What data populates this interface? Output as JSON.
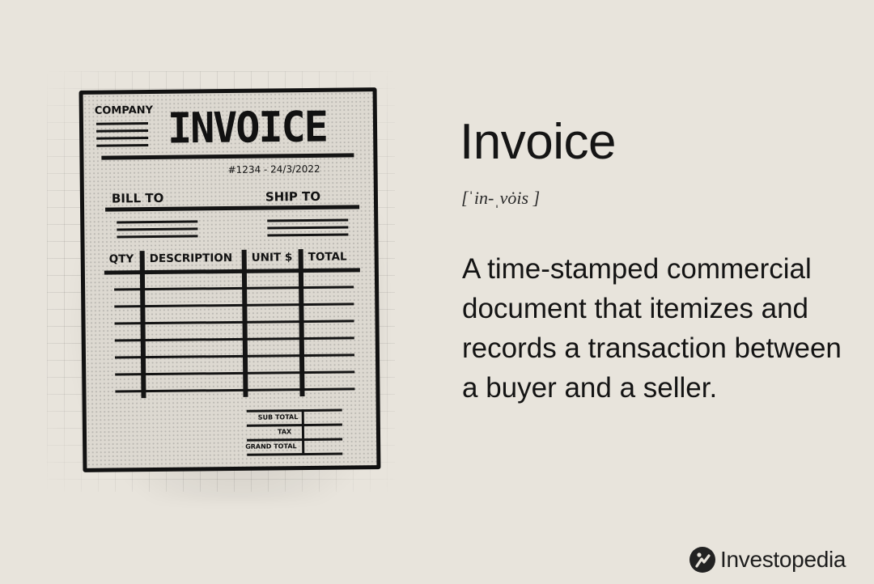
{
  "illustration": {
    "company_label": "COMPANY",
    "heading": "INVOICE",
    "invoice_meta": "#1234 - 24/3/2022",
    "bill_to": "BILL TO",
    "ship_to": "SHIP TO",
    "columns": [
      "QTY",
      "DESCRIPTION",
      "UNIT $",
      "TOTAL"
    ],
    "summary": [
      "SUB TOTAL",
      "TAX",
      "GRAND TOTAL"
    ]
  },
  "definition_card": {
    "term": "Invoice",
    "pronunciation": "[ˈin-ˌvȯis ]",
    "definition": "A time-stamped commercial document that itemizes and records a transaction between a buyer and a seller."
  },
  "brand": {
    "name": "Investopedia",
    "icon": "investopedia-logo-icon"
  }
}
